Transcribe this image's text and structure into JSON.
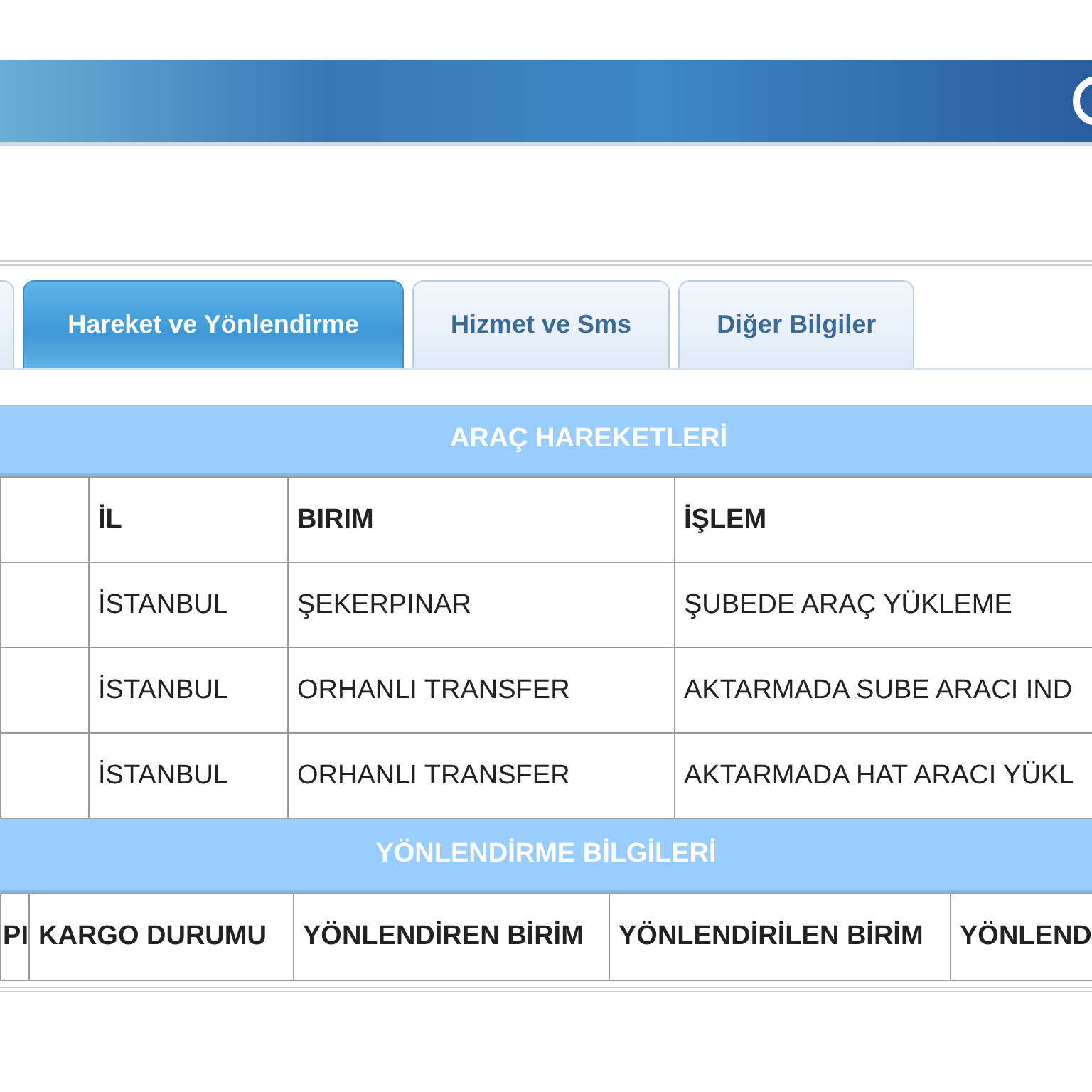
{
  "tabs": [
    {
      "label": "Hareket ve Yönlendirme",
      "selected": true
    },
    {
      "label": "Hizmet ve Sms",
      "selected": false
    },
    {
      "label": "Diğer Bilgiler",
      "selected": false
    }
  ],
  "vehicle_movements": {
    "title": "ARAÇ HAREKETLERİ",
    "columns": [
      "İL",
      "BIRIM",
      "İŞLEM"
    ],
    "rows": [
      [
        "İSTANBUL",
        "ŞEKERPINAR",
        "ŞUBEDE ARAÇ YÜKLEME"
      ],
      [
        "İSTANBUL",
        "ORHANLI TRANSFER",
        "AKTARMADA SUBE ARACI IND"
      ],
      [
        "İSTANBUL",
        "ORHANLI TRANSFER",
        "AKTARMADA HAT ARACI YÜKL"
      ]
    ]
  },
  "routing_info": {
    "title": "YÖNLENDİRME BİLGİLERİ",
    "columns": [
      "PI",
      "KARGO DURUMU",
      "YÖNLENDİREN BİRİM",
      "YÖNLENDİRİLEN BİRİM",
      "YÖNLEND"
    ]
  }
}
